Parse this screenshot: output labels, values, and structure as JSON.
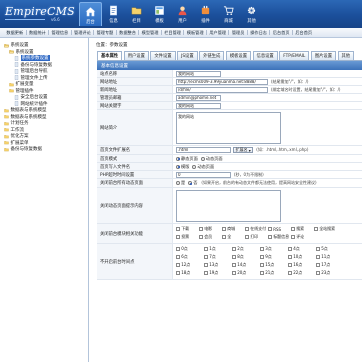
{
  "header": {
    "logo": "EmpireCMS",
    "version": "v6.6",
    "nav": [
      {
        "label": "后台",
        "icon": "home-icon"
      },
      {
        "label": "信息",
        "icon": "document-icon"
      },
      {
        "label": "栏目",
        "icon": "folder-icon"
      },
      {
        "label": "模板",
        "icon": "template-icon"
      },
      {
        "label": "用户",
        "icon": "user-icon"
      },
      {
        "label": "插件",
        "icon": "plugin-icon"
      },
      {
        "label": "商城",
        "icon": "shop-icon"
      },
      {
        "label": "其他",
        "icon": "gear-icon"
      }
    ]
  },
  "subnav": [
    "数据更新",
    "数据统计",
    "管理信息",
    "管理评论",
    "管理专题",
    "数据整合",
    "模型管理",
    "栏目管理",
    "模板管理",
    "用户管理",
    "管理员",
    "操作日志",
    "后台首页",
    "后台首页"
  ],
  "sidebar": {
    "items": [
      {
        "label": "系统设置",
        "level": 0,
        "icon": "folder-open-icon"
      },
      {
        "label": "系统设置",
        "level": 1,
        "icon": "folder-open-icon"
      },
      {
        "label": "系统参数设置",
        "level": 2,
        "icon": "page-icon"
      },
      {
        "label": "备份与恢复数据",
        "level": 2,
        "icon": "page-icon"
      },
      {
        "label": "管理后台导航",
        "level": 2,
        "icon": "page-icon"
      },
      {
        "label": "管理文件上传",
        "level": 2,
        "icon": "page-icon"
      },
      {
        "label": "扩展变量",
        "level": 1,
        "icon": "folder-icon"
      },
      {
        "label": "管理插件",
        "level": 1,
        "icon": "folder-icon"
      },
      {
        "label": "安全后台设置",
        "level": 2,
        "icon": "page-icon"
      },
      {
        "label": "网站统计插件",
        "level": 2,
        "icon": "page-icon"
      },
      {
        "label": "数据表与系统模型",
        "level": 0,
        "icon": "folder-icon"
      },
      {
        "label": "数据表与系统模型",
        "level": 0,
        "icon": "folder-icon"
      },
      {
        "label": "计划任务",
        "level": 0,
        "icon": "folder-icon"
      },
      {
        "label": "工作流",
        "level": 0,
        "icon": "folder-icon"
      },
      {
        "label": "优化方案",
        "level": 0,
        "icon": "folder-icon"
      },
      {
        "label": "扩展菜单",
        "level": 0,
        "icon": "folder-icon"
      },
      {
        "label": "备份与恢复数据",
        "level": 0,
        "icon": "folder-icon"
      }
    ],
    "selected_index": 2
  },
  "main": {
    "location": "位置：参数设置",
    "tabs": [
      "基本属性",
      "用户设置",
      "文件设置",
      "JS设置",
      "外链生成",
      "模板设置",
      "信息设置",
      "FTP/EMAIL",
      "图片设置",
      "其他"
    ],
    "active_tab": 0,
    "section_title": "基本信息设置",
    "rows": {
      "site_name": {
        "label": "站点名称",
        "value": "我的网站"
      },
      "site_url": {
        "label": "网站地址",
        "value": "http://ecms009-3.99yuanma.net:8888/",
        "hint": "(结尾需加\"/\"，如：/)"
      },
      "news_url": {
        "label": "新闻地址",
        "value": "/d/file/",
        "hint": "(绑定域名时设置，结尾需加\"/\"，如：/)"
      },
      "email": {
        "label": "管理员邮箱",
        "value": "admin@phome.net"
      },
      "keywords": {
        "label": "网站关键字",
        "value": "我的网站"
      },
      "description": {
        "label": "网站简介",
        "value": "我的网站"
      },
      "home_ext": {
        "label": "首页文件扩展名",
        "value": ".html",
        "select_label": "扩展名",
        "hint": "(如：.html,.htm,.xml,.php)"
      },
      "home_mode": {
        "label": "首页模式",
        "options": [
          "静态页面",
          "动态页面"
        ],
        "selected": 0
      },
      "home_write": {
        "label": "首页写入文件名",
        "options": [
          "模版",
          "动态页面"
        ],
        "selected": 0
      },
      "php_timeout": {
        "label": "PHP超时时间设置",
        "value": "0",
        "hint": "(秒，0为不限制)"
      },
      "front_close": {
        "label": "关闭前台所有动态页面",
        "options": [
          "是",
          "否"
        ],
        "selected": 1,
        "hint": "(如果开启，前台的有动态文件都无法使用，提高网站安全性建议)"
      },
      "close_tip": {
        "label": "关闭动态页面提示内容",
        "value": ""
      },
      "close_modules": {
        "label": "关闭前台模块相关功能",
        "items": [
          "下载",
          "电影",
          "商城",
          "在线支付",
          "RSS",
          "搜索",
          "全站搜索",
          "投票",
          "会员",
          "全",
          "打印",
          "标题信息",
          "评论"
        ]
      },
      "disable_hours": {
        "label": "不开启前台时间点",
        "items": [
          "0点",
          "1点",
          "2点",
          "3点",
          "4点",
          "5点",
          "6点",
          "7点",
          "8点",
          "9点",
          "10点",
          "11点",
          "12点",
          "13点",
          "14点",
          "15点",
          "16点",
          "17点",
          "18点",
          "19点",
          "20点",
          "21点",
          "22点",
          "23点"
        ]
      }
    }
  },
  "colors": {
    "header": "#1b4f9b",
    "section_head": "#3d72b9",
    "selected": "#316ac5"
  }
}
